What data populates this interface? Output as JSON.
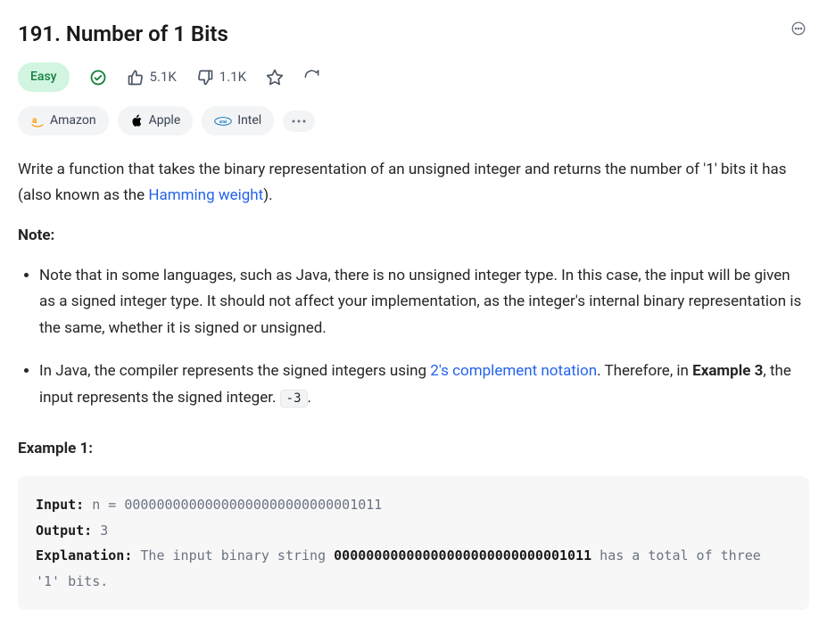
{
  "title": "191. Number of 1 Bits",
  "difficulty": "Easy",
  "stats": {
    "likes": "5.1K",
    "dislikes": "1.1K"
  },
  "tags": {
    "amazon": "Amazon",
    "apple": "Apple",
    "intel": "Intel"
  },
  "description": {
    "p1_pre": "Write a function that takes the binary representation of an unsigned integer and returns the number of '1' bits it has (also known as the ",
    "link1": "Hamming weight",
    "p1_post": ").",
    "note_heading": "Note:",
    "note1": "Note that in some languages, such as Java, there is no unsigned integer type. In this case, the input will be given as a signed integer type. It should not affect your implementation, as the integer's internal binary representation is the same, whether it is signed or unsigned.",
    "note2_pre": "In Java, the compiler represents the signed integers using ",
    "link2": "2's complement notation",
    "note2_mid": ". Therefore, in ",
    "note2_bold": "Example 3",
    "note2_post": ", the input represents the signed integer. ",
    "note2_code": "-3",
    "note2_end": "."
  },
  "example1": {
    "heading": "Example 1:",
    "input_label": "Input:",
    "input_value": " n = 00000000000000000000000000001011",
    "output_label": "Output:",
    "output_value": " 3",
    "explanation_label": "Explanation:",
    "explanation_pre": " The input binary string ",
    "explanation_strong": "00000000000000000000000000001011",
    "explanation_post": " has a total of three '1' bits."
  }
}
